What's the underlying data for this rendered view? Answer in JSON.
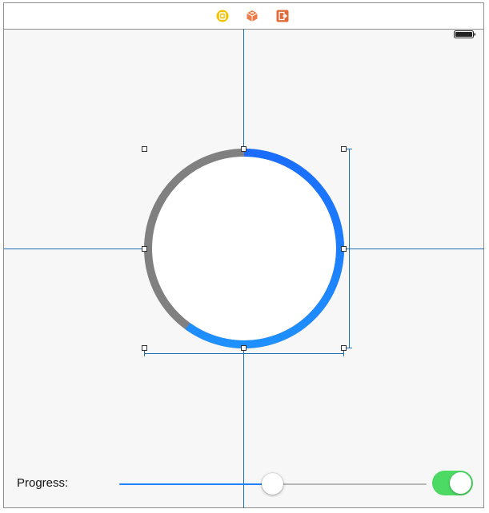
{
  "scene_bar": {
    "icons": [
      "view-controller-icon",
      "first-responder-icon",
      "exit-icon"
    ]
  },
  "status_bar": {
    "icon": "battery-icon"
  },
  "progress_ring": {
    "progress": 0.6,
    "track_color": "#808080",
    "progress_color_start": "#1a6dff",
    "progress_color_end": "#1e90ff"
  },
  "controls": {
    "progress_label": "Progress:",
    "slider_value": 0.5,
    "slider_min_track_color": "#1e82ff",
    "slider_max_track_color": "#b5b5b5",
    "switch_on": true,
    "switch_color": "#4cd964"
  },
  "guide_color": "#1f6fb5"
}
